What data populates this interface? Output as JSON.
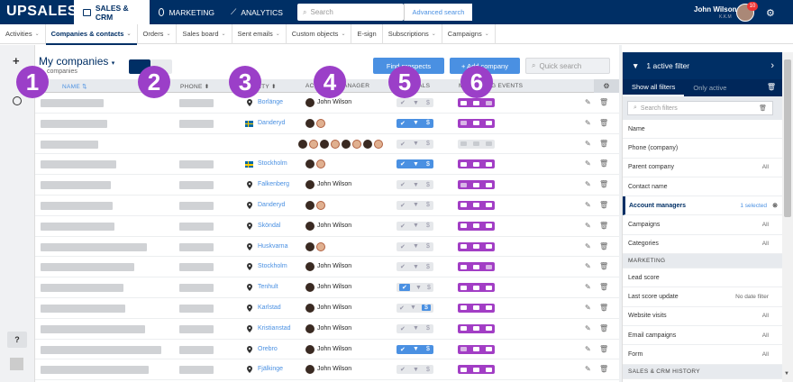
{
  "app": {
    "logo": "UPSALES"
  },
  "topnav": [
    {
      "label": "SALES & CRM",
      "active": true,
      "icon": "briefcase-icon"
    },
    {
      "label": "MARKETING",
      "active": false,
      "icon": "target-icon"
    },
    {
      "label": "ANALYTICS",
      "active": false,
      "icon": "chart-icon"
    }
  ],
  "search": {
    "placeholder": "Search",
    "advanced": "Advanced search"
  },
  "user": {
    "name": "John Wilson",
    "role": "K.K.M",
    "notifications": "10"
  },
  "subnav": [
    {
      "label": "Activities",
      "active": false,
      "dropdown": true
    },
    {
      "label": "Companies & contacts",
      "active": true,
      "dropdown": true
    },
    {
      "label": "Orders",
      "active": false,
      "dropdown": true
    },
    {
      "label": "Sales board",
      "active": false,
      "dropdown": true
    },
    {
      "label": "Sent emails",
      "active": false,
      "dropdown": true
    },
    {
      "label": "Custom objects",
      "active": false,
      "dropdown": true
    },
    {
      "label": "E-sign",
      "active": false,
      "dropdown": false
    },
    {
      "label": "Subscriptions",
      "active": false,
      "dropdown": true
    },
    {
      "label": "Campaigns",
      "active": false,
      "dropdown": true
    }
  ],
  "rail": {
    "plus": "+",
    "help": "?"
  },
  "main": {
    "title": "My companies",
    "subtitle": "companies",
    "find_prospects": "Find prospects",
    "add_company": "+ Add company",
    "quick_search": "Quick search",
    "columns": {
      "name": "NAME",
      "phone": "PHONE",
      "city": "CITY",
      "manager": "ACCOUNT MANAGER",
      "signals": "SIGNALS",
      "marketing": "MARKETING EVENTS"
    }
  },
  "rows": [
    {
      "city": "Borlänge",
      "flag": false,
      "manager": "John Wilson",
      "managers_extra": 0,
      "signals": "off",
      "marketing": [
        true,
        true,
        false
      ]
    },
    {
      "city": "Danderyd",
      "flag": true,
      "manager": "",
      "managers_extra": 2,
      "signals": "on",
      "marketing": [
        false,
        true,
        true
      ]
    },
    {
      "city": "",
      "flag": false,
      "manager": "",
      "managers_extra": 8,
      "signals": "off",
      "marketing": [
        false,
        false,
        false
      ]
    },
    {
      "city": "Stockholm",
      "flag": true,
      "manager": "",
      "managers_extra": 2,
      "signals": "on",
      "marketing": [
        true,
        true,
        true
      ]
    },
    {
      "city": "Falkenberg",
      "flag": false,
      "manager": "John Wilson",
      "managers_extra": 0,
      "signals": "off",
      "marketing": [
        false,
        true,
        true
      ]
    },
    {
      "city": "Danderyd",
      "flag": false,
      "manager": "",
      "managers_extra": 2,
      "signals": "off",
      "marketing": [
        true,
        true,
        true
      ]
    },
    {
      "city": "Sköndal",
      "flag": false,
      "manager": "John Wilson",
      "managers_extra": 0,
      "signals": "off",
      "marketing": [
        true,
        true,
        true
      ]
    },
    {
      "city": "Huskvarna",
      "flag": false,
      "manager": "",
      "managers_extra": 2,
      "signals": "off",
      "marketing": [
        true,
        true,
        true
      ]
    },
    {
      "city": "Stockholm",
      "flag": false,
      "manager": "John Wilson",
      "managers_extra": 0,
      "signals": "off",
      "marketing": [
        true,
        true,
        false
      ]
    },
    {
      "city": "Tenhult",
      "flag": false,
      "manager": "John Wilson",
      "managers_extra": 0,
      "signals": "half",
      "marketing": [
        true,
        true,
        true
      ]
    },
    {
      "city": "Karlstad",
      "flag": false,
      "manager": "John Wilson",
      "managers_extra": 0,
      "signals": "dollar",
      "marketing": [
        true,
        true,
        true
      ]
    },
    {
      "city": "Kristianstad",
      "flag": false,
      "manager": "John Wilson",
      "managers_extra": 0,
      "signals": "off",
      "marketing": [
        true,
        true,
        true
      ]
    },
    {
      "city": "Orebro",
      "flag": false,
      "manager": "John Wilson",
      "managers_extra": 0,
      "signals": "on",
      "marketing": [
        false,
        true,
        true
      ]
    },
    {
      "city": "Fjälkinge",
      "flag": false,
      "manager": "John Wilson",
      "managers_extra": 0,
      "signals": "off",
      "marketing": [
        true,
        true,
        true
      ]
    }
  ],
  "callouts": [
    "1",
    "2",
    "3",
    "4",
    "5",
    "6"
  ],
  "panel": {
    "header": "1 active filter",
    "tab_all": "Show all filters",
    "tab_active": "Only active",
    "search_placeholder": "Search filters",
    "items": [
      {
        "label": "Name",
        "value": "",
        "section": false,
        "selected": false
      },
      {
        "label": "Phone (company)",
        "value": "",
        "section": false,
        "selected": false
      },
      {
        "label": "Parent company",
        "value": "All",
        "section": false,
        "selected": false
      },
      {
        "label": "Contact name",
        "value": "",
        "section": false,
        "selected": false
      },
      {
        "label": "Account managers",
        "value": "1 selected",
        "section": false,
        "selected": true
      },
      {
        "label": "Campaigns",
        "value": "All",
        "section": false,
        "selected": false
      },
      {
        "label": "Categories",
        "value": "All",
        "section": false,
        "selected": false
      },
      {
        "label": "MARKETING",
        "value": "",
        "section": true,
        "selected": false
      },
      {
        "label": "Lead score",
        "value": "",
        "section": false,
        "selected": false
      },
      {
        "label": "Last score update",
        "value": "No date filter",
        "section": false,
        "selected": false
      },
      {
        "label": "Website visits",
        "value": "All",
        "section": false,
        "selected": false
      },
      {
        "label": "Email campaigns",
        "value": "All",
        "section": false,
        "selected": false
      },
      {
        "label": "Form",
        "value": "All",
        "section": false,
        "selected": false
      },
      {
        "label": "SALES & CRM HISTORY",
        "value": "",
        "section": true,
        "selected": false
      }
    ]
  },
  "colors": {
    "navy": "#002f65",
    "blue": "#4a90e2",
    "purple": "#a23ec5",
    "callout": "#9b3fc8"
  }
}
